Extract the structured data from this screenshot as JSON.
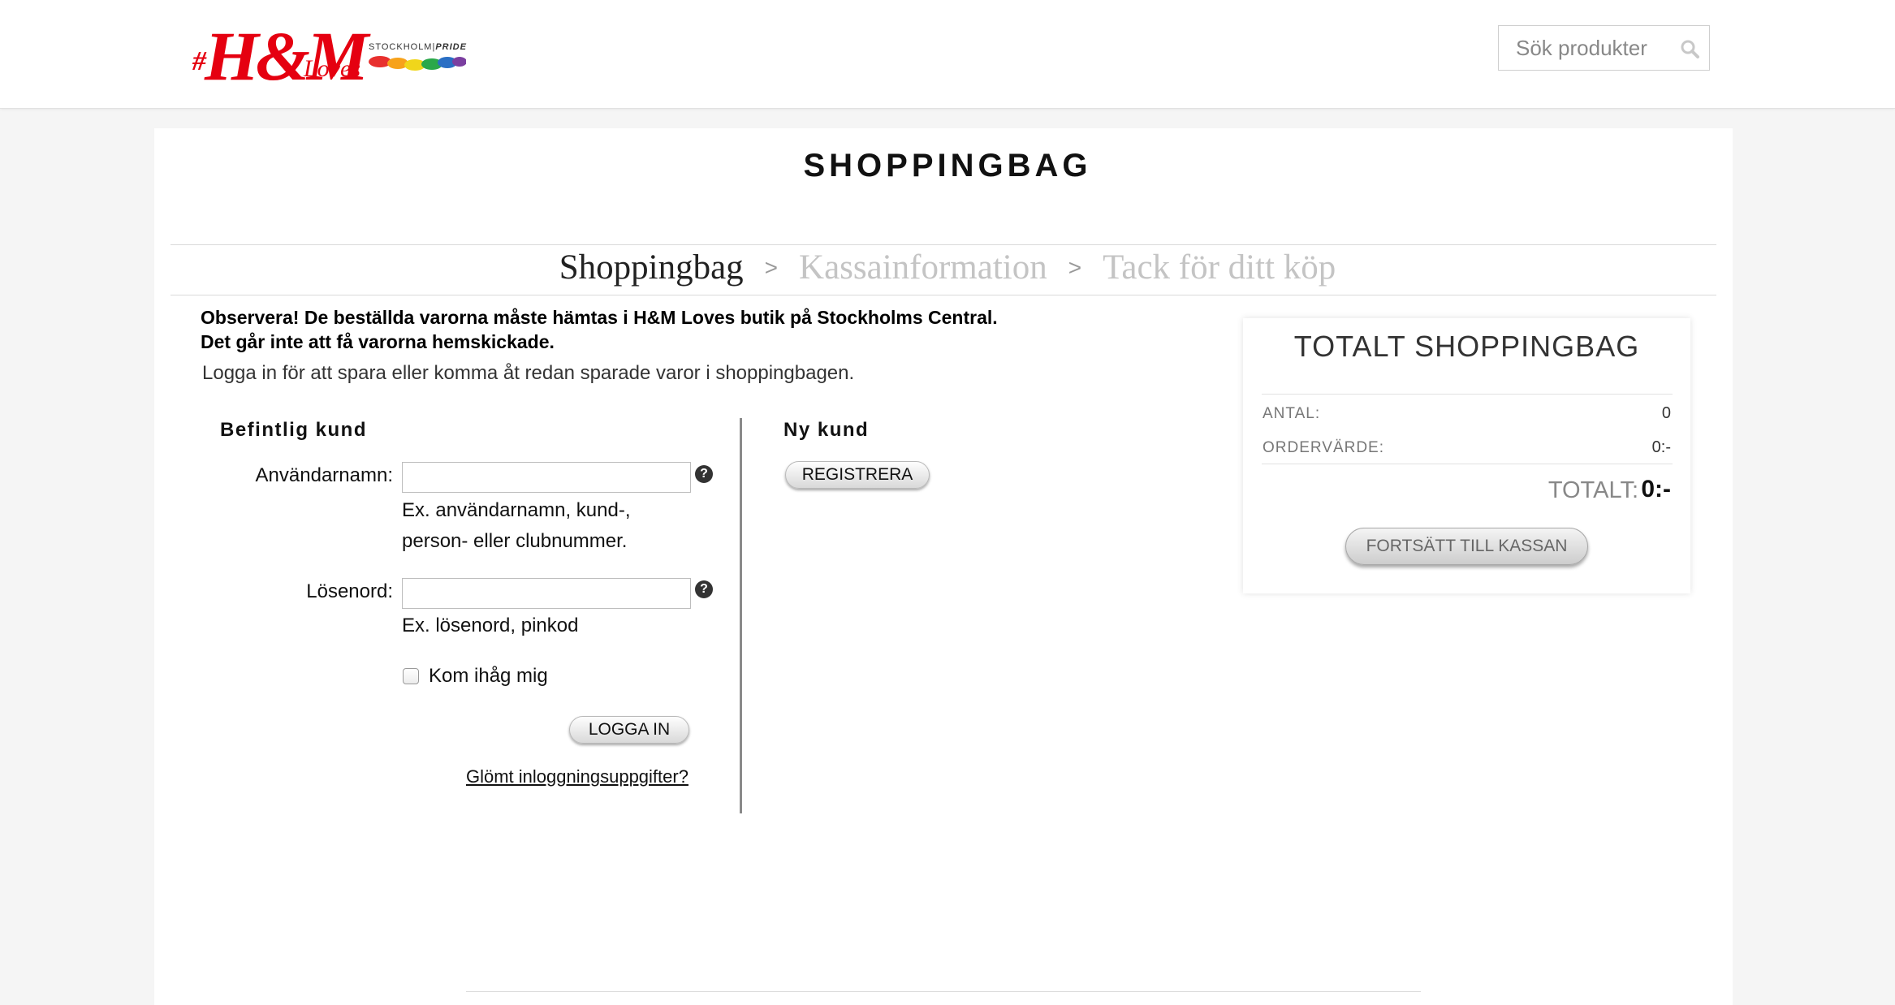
{
  "header": {
    "logo": {
      "hash": "#",
      "brand": "H&M",
      "loves": "Loves",
      "pride_city": "STOCKHOLM",
      "pride_word": "PRIDE"
    },
    "search": {
      "placeholder": "Sök produkter",
      "icon": "search-icon"
    }
  },
  "page_title": "SHOPPINGBAG",
  "steps": {
    "items": [
      "Shoppingbag",
      "Kassainformation",
      "Tack för ditt köp"
    ],
    "active_index": 0
  },
  "notice": {
    "line1": "Observera! De beställda varorna måste hämtas i H&M Loves butik på Stockholms Central.",
    "line2": "Det går inte att få varorna hemskickade."
  },
  "login_hint": "Logga in för att spara eller komma åt redan sparade varor i shoppingbagen.",
  "existing_customer": {
    "heading": "Befintlig kund",
    "username_label": "Användarnamn:",
    "username_value": "",
    "username_hint_line1": "Ex. användarnamn, kund-,",
    "username_hint_line2": "person- eller clubnummer.",
    "password_label": "Lösenord:",
    "password_value": "",
    "password_hint": "Ex. lösenord, pinkod",
    "remember_label": "Kom ihåg mig",
    "remember_checked": false,
    "login_button": "LOGGA IN",
    "forgot_link": "Glömt inloggningsuppgifter?",
    "help_icon": "?"
  },
  "new_customer": {
    "heading": "Ny kund",
    "register_button": "REGISTRERA"
  },
  "summary": {
    "title": "TOTALT SHOPPINGBAG",
    "quantity_label": "ANTAL:",
    "quantity_value": "0",
    "order_value_label": "ORDERVÄRDE:",
    "order_value": "0:-",
    "total_label": "TOTALT:",
    "total_value": "0:-",
    "checkout_button": "FORTSÄTT TILL KASSAN"
  },
  "colors": {
    "brand_red": "#e50010",
    "inactive_step": "#c4c4c4"
  }
}
